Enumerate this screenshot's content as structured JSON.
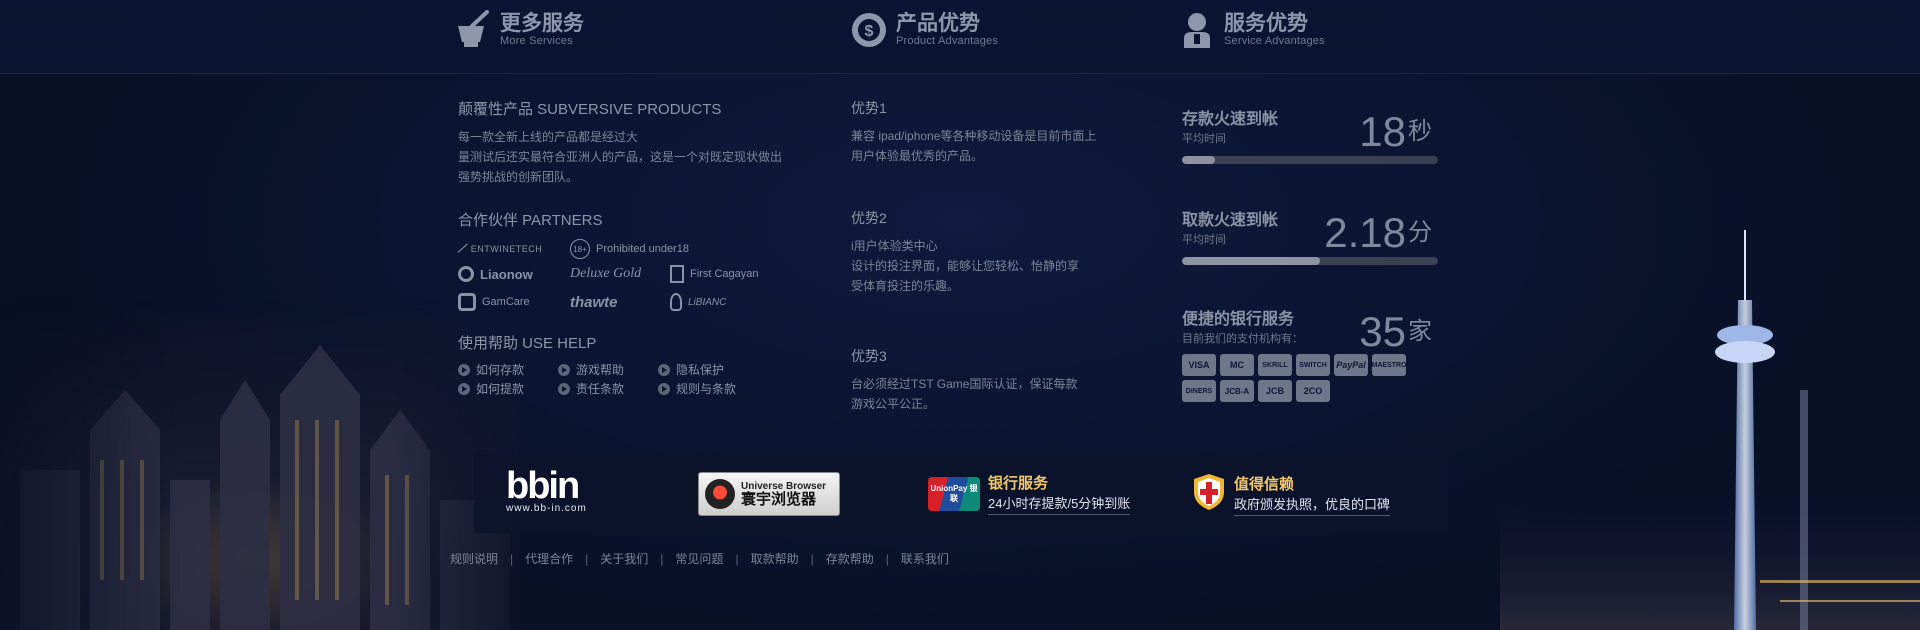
{
  "header": {
    "more_services": {
      "title": "更多服务",
      "subtitle": "More Services",
      "icon": "mortar-pestle-icon"
    },
    "product_advantages": {
      "title": "产品优势",
      "subtitle": "Product Advantages",
      "icon": "dollar-chip-icon"
    },
    "service_advantages": {
      "title": "服务优势",
      "subtitle": "Service Advantages",
      "icon": "agent-icon"
    }
  },
  "products": {
    "title": "颠覆性产品 SUBVERSIVE PRODUCTS",
    "lines": [
      "每一款全新上线的产品都是经过大",
      "量测试后还实最符合亚洲人的产品，这是一个对既定现状做出",
      "强势挑战的创新团队。"
    ]
  },
  "partners": {
    "title": "合作伙伴 PARTNERS",
    "items": [
      {
        "label": "ENTWINETECH"
      },
      {
        "label": "Prohibited under18",
        "badge": "18+"
      },
      {
        "label": "Liaonow"
      },
      {
        "label": "Deluxe Gold"
      },
      {
        "label": "First Cagayan"
      },
      {
        "label": "GamCare"
      },
      {
        "label": "thawte"
      },
      {
        "label": "LiBIANC"
      }
    ]
  },
  "help": {
    "title": "使用帮助 USE HELP",
    "items": [
      "如何存款",
      "游戏帮助",
      "隐私保护",
      "如何提款",
      "责任条款",
      "规则与条款"
    ]
  },
  "advantages": [
    {
      "title": "优势1",
      "lines": [
        "兼容 ipad/iphone等各种移动设备是目前市面上",
        "用户体验最优秀的产品。"
      ]
    },
    {
      "title": "优势2",
      "lines": [
        "i用户体验类中心",
        "设计的投注界面，能够让您轻松、怡静的享",
        "受体育投注的乐趣。"
      ]
    },
    {
      "title": "优势3",
      "lines": [
        "台必须经过TST Game国际认证，保证每款",
        "游戏公平公正。"
      ]
    }
  ],
  "stats": [
    {
      "title": "存款火速到帐",
      "sub": "平均时间",
      "value": "18",
      "unit": "秒",
      "progress": 0.13
    },
    {
      "title": "取款火速到帐",
      "sub": "平均时间",
      "value": "2.18",
      "unit": "分",
      "progress": 0.54
    },
    {
      "title": "便捷的银行服务",
      "sub": "目前我们的支付机构有：",
      "value": "35",
      "unit": "家"
    }
  ],
  "payments": [
    "VISA",
    "MC",
    "SKRILL",
    "SWITCH",
    "PayPal",
    "MAESTRO",
    "DINERS",
    "JCB-A",
    "JCB",
    "2CO"
  ],
  "logos": {
    "bbin": {
      "name": "bbin",
      "url": "www.bb-in.com"
    },
    "browser": {
      "title": "Universe Browser",
      "cn": "寰宇浏览器"
    },
    "bank": {
      "brand": "UnionPay 银联",
      "title": "银行服务",
      "desc": "24小时存提款/5分钟到账"
    },
    "trust": {
      "title": "值得信赖",
      "desc": "政府颁发执照，优良的口碑"
    }
  },
  "footer": [
    "规则说明",
    "代理合作",
    "关于我们",
    "常见问题",
    "取款帮助",
    "存款帮助",
    "联系我们"
  ]
}
